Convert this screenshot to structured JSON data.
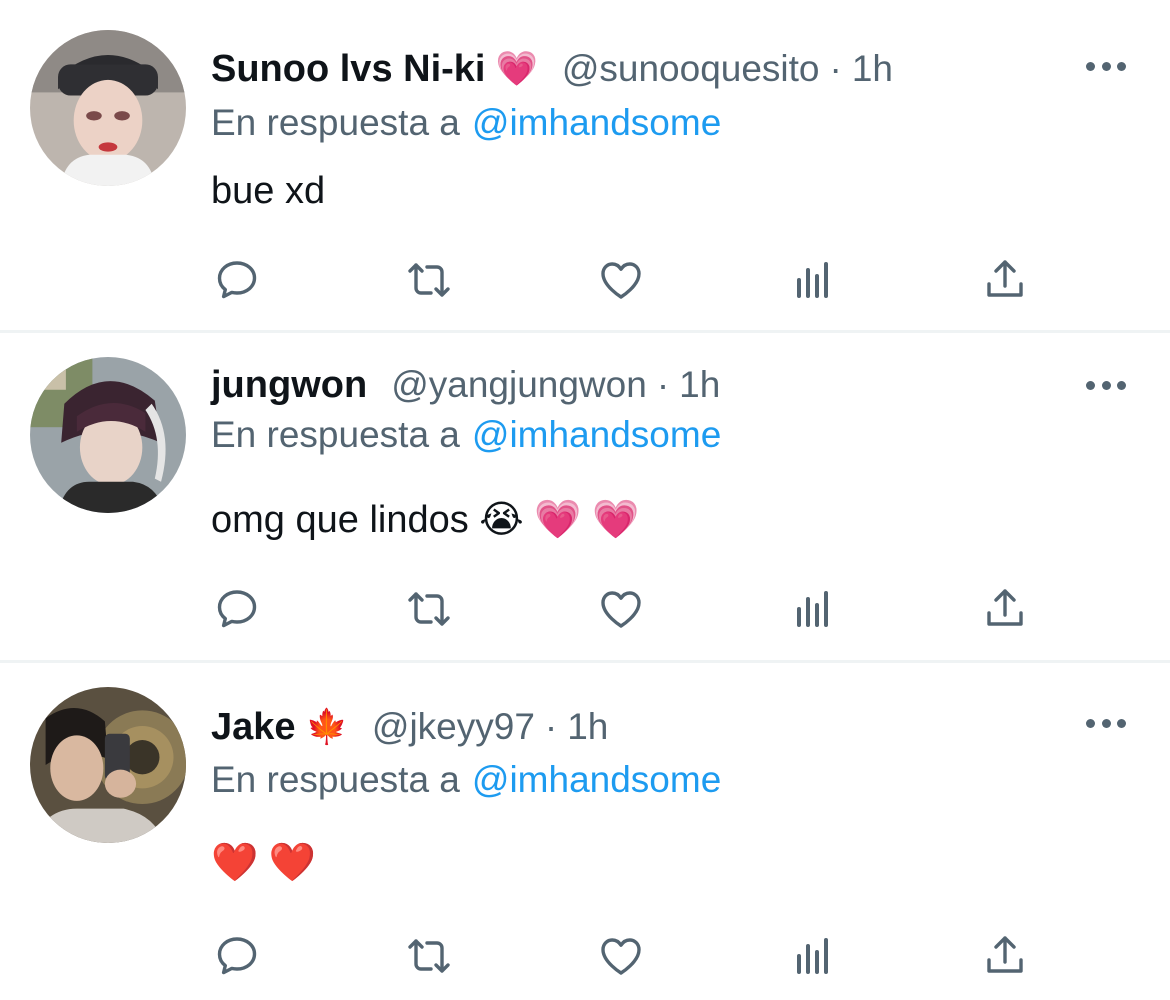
{
  "colors": {
    "text_primary": "#0f1419",
    "text_secondary": "#536471",
    "link": "#1d9bf0",
    "divider": "#eff3f4"
  },
  "icons": [
    "more-icon",
    "reply-icon",
    "retweet-icon",
    "like-icon",
    "views-icon",
    "share-icon"
  ],
  "tweets": [
    {
      "display_name": "Sunoo lvs Ni-ki",
      "name_emoji": "💗",
      "handle": "@sunooquesito",
      "separator": "·",
      "time": "1h",
      "reply_prefix": "En respuesta a",
      "reply_to": "@imhandsome",
      "text": "bue xd"
    },
    {
      "display_name": "jungwon",
      "name_emoji": "",
      "handle": "@yangjungwon",
      "separator": "·",
      "time": "1h",
      "reply_prefix": "En respuesta a",
      "reply_to": "@imhandsome",
      "text": "omg que lindos 😭 💗 💗"
    },
    {
      "display_name": "Jake",
      "name_emoji": "🍁",
      "handle": "@jkeyy97",
      "separator": "·",
      "time": "1h",
      "reply_prefix": "En respuesta a",
      "reply_to": "@imhandsome",
      "text": "❤️ ❤️"
    }
  ]
}
